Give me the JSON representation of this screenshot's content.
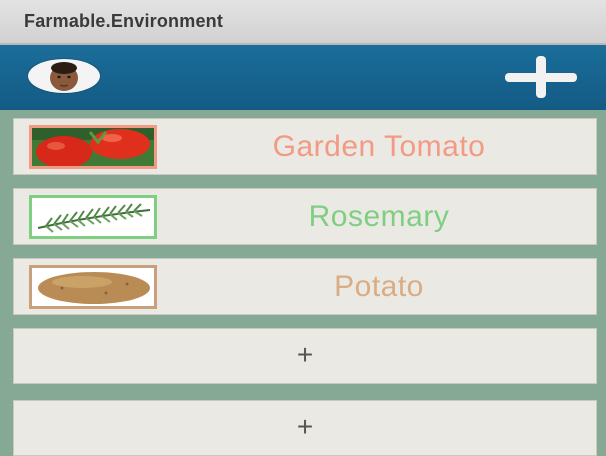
{
  "window": {
    "title": "Farmable.Environment"
  },
  "actionbar": {
    "add_icon": "plus-icon",
    "avatar_icon": "user-avatar"
  },
  "plants": [
    {
      "name": "Garden Tomato",
      "color": "#f29a84",
      "border": "#f29a84",
      "image": "tomato"
    },
    {
      "name": "Rosemary",
      "color": "#7fcf83",
      "border": "#7fcf83",
      "image": "rosemary"
    },
    {
      "name": "Potato",
      "color": "#d8ad86",
      "border": "#caa07b",
      "image": "potato"
    }
  ],
  "empty_slots": [
    {
      "label": "+"
    },
    {
      "label": "+"
    }
  ],
  "colors": {
    "titlebar": "#d8d8d8",
    "actionbar": "#17648f",
    "list_background": "#86a995",
    "card": "#eae9e3"
  }
}
